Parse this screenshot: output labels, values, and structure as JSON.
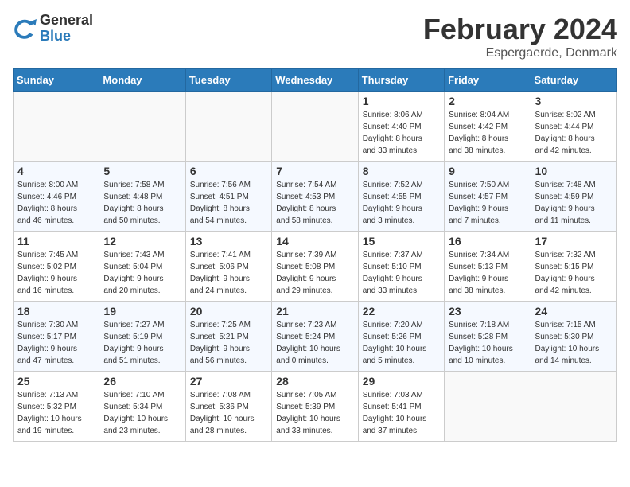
{
  "header": {
    "logo_general": "General",
    "logo_blue": "Blue",
    "month_year": "February 2024",
    "location": "Espergaerde, Denmark"
  },
  "weekdays": [
    "Sunday",
    "Monday",
    "Tuesday",
    "Wednesday",
    "Thursday",
    "Friday",
    "Saturday"
  ],
  "weeks": [
    [
      {
        "day": "",
        "detail": ""
      },
      {
        "day": "",
        "detail": ""
      },
      {
        "day": "",
        "detail": ""
      },
      {
        "day": "",
        "detail": ""
      },
      {
        "day": "1",
        "detail": "Sunrise: 8:06 AM\nSunset: 4:40 PM\nDaylight: 8 hours\nand 33 minutes."
      },
      {
        "day": "2",
        "detail": "Sunrise: 8:04 AM\nSunset: 4:42 PM\nDaylight: 8 hours\nand 38 minutes."
      },
      {
        "day": "3",
        "detail": "Sunrise: 8:02 AM\nSunset: 4:44 PM\nDaylight: 8 hours\nand 42 minutes."
      }
    ],
    [
      {
        "day": "4",
        "detail": "Sunrise: 8:00 AM\nSunset: 4:46 PM\nDaylight: 8 hours\nand 46 minutes."
      },
      {
        "day": "5",
        "detail": "Sunrise: 7:58 AM\nSunset: 4:48 PM\nDaylight: 8 hours\nand 50 minutes."
      },
      {
        "day": "6",
        "detail": "Sunrise: 7:56 AM\nSunset: 4:51 PM\nDaylight: 8 hours\nand 54 minutes."
      },
      {
        "day": "7",
        "detail": "Sunrise: 7:54 AM\nSunset: 4:53 PM\nDaylight: 8 hours\nand 58 minutes."
      },
      {
        "day": "8",
        "detail": "Sunrise: 7:52 AM\nSunset: 4:55 PM\nDaylight: 9 hours\nand 3 minutes."
      },
      {
        "day": "9",
        "detail": "Sunrise: 7:50 AM\nSunset: 4:57 PM\nDaylight: 9 hours\nand 7 minutes."
      },
      {
        "day": "10",
        "detail": "Sunrise: 7:48 AM\nSunset: 4:59 PM\nDaylight: 9 hours\nand 11 minutes."
      }
    ],
    [
      {
        "day": "11",
        "detail": "Sunrise: 7:45 AM\nSunset: 5:02 PM\nDaylight: 9 hours\nand 16 minutes."
      },
      {
        "day": "12",
        "detail": "Sunrise: 7:43 AM\nSunset: 5:04 PM\nDaylight: 9 hours\nand 20 minutes."
      },
      {
        "day": "13",
        "detail": "Sunrise: 7:41 AM\nSunset: 5:06 PM\nDaylight: 9 hours\nand 24 minutes."
      },
      {
        "day": "14",
        "detail": "Sunrise: 7:39 AM\nSunset: 5:08 PM\nDaylight: 9 hours\nand 29 minutes."
      },
      {
        "day": "15",
        "detail": "Sunrise: 7:37 AM\nSunset: 5:10 PM\nDaylight: 9 hours\nand 33 minutes."
      },
      {
        "day": "16",
        "detail": "Sunrise: 7:34 AM\nSunset: 5:13 PM\nDaylight: 9 hours\nand 38 minutes."
      },
      {
        "day": "17",
        "detail": "Sunrise: 7:32 AM\nSunset: 5:15 PM\nDaylight: 9 hours\nand 42 minutes."
      }
    ],
    [
      {
        "day": "18",
        "detail": "Sunrise: 7:30 AM\nSunset: 5:17 PM\nDaylight: 9 hours\nand 47 minutes."
      },
      {
        "day": "19",
        "detail": "Sunrise: 7:27 AM\nSunset: 5:19 PM\nDaylight: 9 hours\nand 51 minutes."
      },
      {
        "day": "20",
        "detail": "Sunrise: 7:25 AM\nSunset: 5:21 PM\nDaylight: 9 hours\nand 56 minutes."
      },
      {
        "day": "21",
        "detail": "Sunrise: 7:23 AM\nSunset: 5:24 PM\nDaylight: 10 hours\nand 0 minutes."
      },
      {
        "day": "22",
        "detail": "Sunrise: 7:20 AM\nSunset: 5:26 PM\nDaylight: 10 hours\nand 5 minutes."
      },
      {
        "day": "23",
        "detail": "Sunrise: 7:18 AM\nSunset: 5:28 PM\nDaylight: 10 hours\nand 10 minutes."
      },
      {
        "day": "24",
        "detail": "Sunrise: 7:15 AM\nSunset: 5:30 PM\nDaylight: 10 hours\nand 14 minutes."
      }
    ],
    [
      {
        "day": "25",
        "detail": "Sunrise: 7:13 AM\nSunset: 5:32 PM\nDaylight: 10 hours\nand 19 minutes."
      },
      {
        "day": "26",
        "detail": "Sunrise: 7:10 AM\nSunset: 5:34 PM\nDaylight: 10 hours\nand 23 minutes."
      },
      {
        "day": "27",
        "detail": "Sunrise: 7:08 AM\nSunset: 5:36 PM\nDaylight: 10 hours\nand 28 minutes."
      },
      {
        "day": "28",
        "detail": "Sunrise: 7:05 AM\nSunset: 5:39 PM\nDaylight: 10 hours\nand 33 minutes."
      },
      {
        "day": "29",
        "detail": "Sunrise: 7:03 AM\nSunset: 5:41 PM\nDaylight: 10 hours\nand 37 minutes."
      },
      {
        "day": "",
        "detail": ""
      },
      {
        "day": "",
        "detail": ""
      }
    ]
  ]
}
